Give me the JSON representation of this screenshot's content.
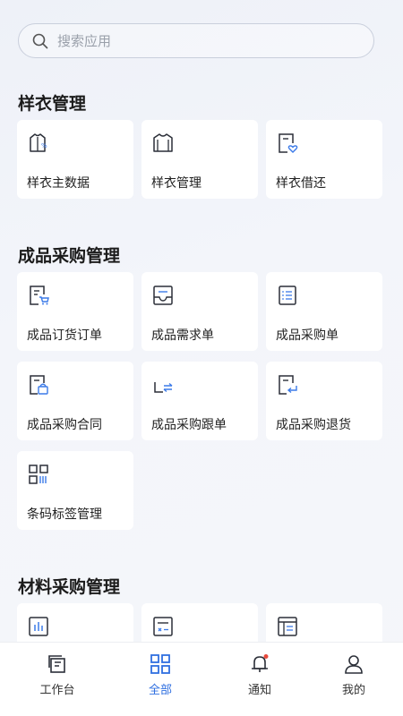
{
  "search": {
    "placeholder": "搜索应用"
  },
  "sections": [
    {
      "title": "样衣管理",
      "items": [
        "样衣主数据",
        "样衣管理",
        "样衣借还"
      ]
    },
    {
      "title": "成品采购管理",
      "items": [
        "成品订货订单",
        "成品需求单",
        "成品采购单",
        "成品采购合同",
        "成品采购跟单",
        "成品采购退货",
        "条码标签管理"
      ]
    },
    {
      "title": "材料采购管理",
      "items": []
    }
  ],
  "tabs": [
    {
      "label": "工作台",
      "icon": "workbench-icon",
      "active": false
    },
    {
      "label": "全部",
      "icon": "grid-icon",
      "active": true
    },
    {
      "label": "通知",
      "icon": "bell-icon",
      "active": false,
      "badge": true
    },
    {
      "label": "我的",
      "icon": "user-icon",
      "active": false
    }
  ],
  "colors": {
    "accent": "#2f6fe0",
    "badge": "#e84a3d",
    "icon": "#2b2f38",
    "icon_accent": "#3b7ae8"
  }
}
